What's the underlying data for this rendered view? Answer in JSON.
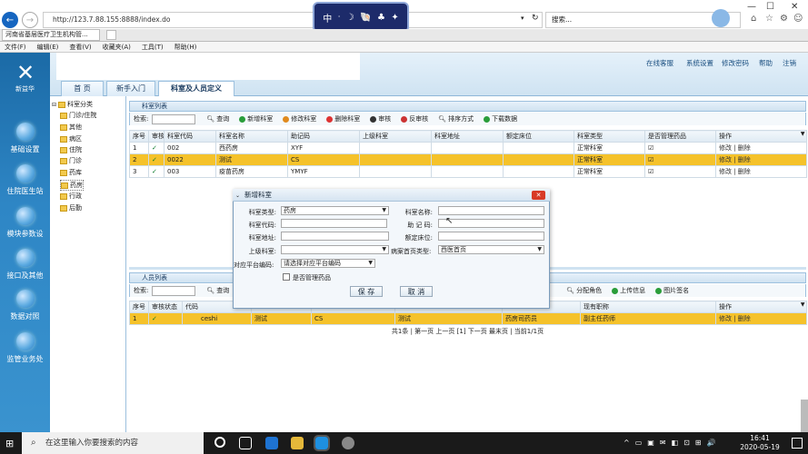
{
  "browser": {
    "url": "http://123.7.88.155:8888/index.do",
    "search_placeholder": "搜索...",
    "tab_title": "河南省基层医疗卫生机构管...",
    "menu": [
      "文件(F)",
      "编辑(E)",
      "查看(V)",
      "收藏夹(A)",
      "工具(T)",
      "帮助(H)"
    ],
    "ime": [
      "中",
      "ᐧ",
      "☽",
      "🐚",
      "♣",
      "✦"
    ]
  },
  "app": {
    "logo_text": "新益华",
    "top_links": [
      "在线客服",
      "系统设置",
      "修改密码",
      "帮助",
      "注销"
    ],
    "main_tabs": [
      "首 页",
      "新手入门",
      "科室及人员定义"
    ],
    "sidebar": [
      "基础设置",
      "住院医生站",
      "模块参数设",
      "接口及其他",
      "数据对照",
      "监管业务处"
    ],
    "tree": {
      "root": "科室分类",
      "items": [
        "门诊/住院",
        "其他",
        "病区",
        "住院",
        "门诊",
        "药库",
        "药房",
        "行政",
        "后勤"
      ]
    }
  },
  "dept_panel": {
    "title": "科室列表",
    "search_label": "检索:",
    "toolbar": [
      "查询",
      "新增科室",
      "修改科室",
      "删除科室",
      "审核",
      "反审核",
      "排序方式",
      "下载数据"
    ],
    "columns": [
      "序号",
      "审核",
      "科室代码",
      "科室名称",
      "助记码",
      "上级科室",
      "科室地址",
      "额定床位",
      "科室类型",
      "是否管理药品",
      "操作"
    ],
    "rows": [
      {
        "no": "1",
        "code": "002",
        "name": "西药房",
        "mnemonic": "XYF",
        "type": "正常科室",
        "ops": "修改 | 删除"
      },
      {
        "no": "2",
        "code": "0022",
        "name": "测试",
        "mnemonic": "CS",
        "type": "正常科室",
        "ops": "修改 | 删除"
      },
      {
        "no": "3",
        "code": "003",
        "name": "疫苗药房",
        "mnemonic": "YMYF",
        "type": "正常科室",
        "ops": "修改 | 删除"
      }
    ]
  },
  "staff_panel": {
    "title": "人员列表",
    "search_label": "检索:",
    "toolbar_left": [
      "查询"
    ],
    "toolbar_right": [
      "分配角色",
      "上传信息",
      "图片签名"
    ],
    "columns": [
      "序号",
      "审核状态",
      "代码",
      "现有职称",
      "操作"
    ],
    "rows": [
      {
        "no": "1",
        "code": "ceshi",
        "name": "测试",
        "mnemonic": "CS",
        "dept": "测试",
        "role": "药房司药员",
        "title": "副主任药师",
        "ops": "修改 | 删除"
      }
    ],
    "pager": "共1条 | 第一页 上一页 [1] 下一页 最末页 | 当前1/1页"
  },
  "dialog": {
    "title": "新增科室",
    "labels": {
      "dept_type": "科室类型:",
      "dept_name": "科室名称:",
      "dept_code": "科室代码:",
      "mnemonic": "助 记 码:",
      "address": "科室地址:",
      "beds": "额定床位:",
      "parent": "上级科室:",
      "homepage_type": "病案首页类型:",
      "platform_code": "对应平台编码:",
      "manage_drugs": "是否管理药品"
    },
    "values": {
      "dept_type": "药房",
      "homepage_type": "西医首页",
      "platform_code": "请选择对应平台编码"
    },
    "save": "保 存",
    "cancel": "取 消"
  },
  "taskbar": {
    "search_placeholder": "在这里输入你要搜索的内容",
    "time": "16:41",
    "date": "2020-05-19"
  }
}
